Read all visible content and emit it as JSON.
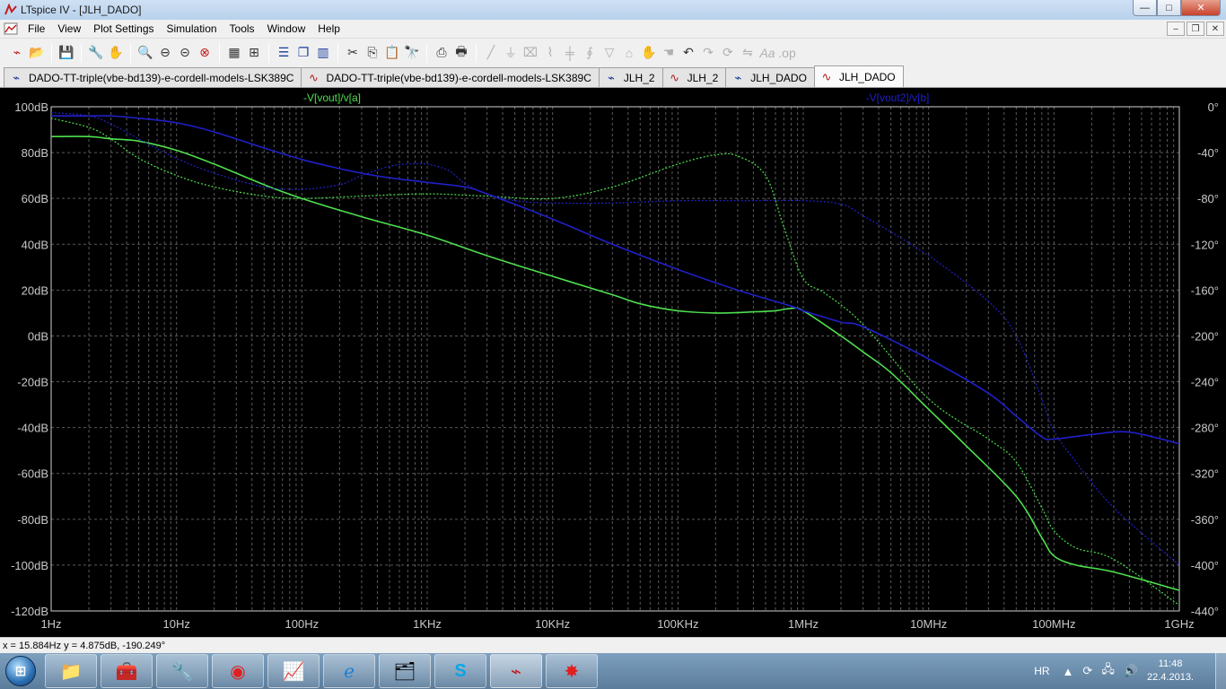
{
  "window": {
    "title": "LTspice IV - [JLH_DADO]",
    "controls": {
      "minimize": "—",
      "maximize": "□",
      "close": "✕"
    }
  },
  "menu": {
    "items": [
      "File",
      "View",
      "Plot Settings",
      "Simulation",
      "Tools",
      "Window",
      "Help"
    ],
    "mdi_controls": {
      "minimize": "–",
      "restore": "❐",
      "close": "✕"
    }
  },
  "toolbar": {
    "groups": [
      [
        "schematic-run-icon",
        "open-icon"
      ],
      [
        "save-icon"
      ],
      [
        "control-panel-icon",
        "hand-pan-icon"
      ],
      [
        "zoom-in-icon",
        "zoom-out-icon",
        "zoom-back-icon",
        "zoom-fit-icon"
      ],
      [
        "autorange-icon",
        "marker-icon"
      ],
      [
        "tile-horizontal-icon",
        "cascade-icon",
        "tile-vertical-icon"
      ],
      [
        "cut-icon",
        "copy-icon",
        "paste-icon",
        "find-icon"
      ],
      [
        "print-setup-icon",
        "print-icon"
      ],
      [
        "wire-icon",
        "ground-icon",
        "label-icon",
        "resistor-icon",
        "capacitor-icon",
        "inductor-icon",
        "diode-icon",
        "component-icon",
        "move-icon",
        "drag-icon",
        "undo-icon",
        "redo-icon",
        "rotate-icon",
        "mirror-icon",
        "text-icon",
        "spice-directive-icon"
      ]
    ]
  },
  "tabs": [
    {
      "label": "DADO-TT-triple(vbe-bd139)-e-cordell-models-LSK389C",
      "type": "schematic",
      "active": false
    },
    {
      "label": "DADO-TT-triple(vbe-bd139)-e-cordell-models-LSK389C",
      "type": "plot",
      "active": false
    },
    {
      "label": "JLH_2",
      "type": "schematic",
      "active": false
    },
    {
      "label": "JLH_2",
      "type": "plot",
      "active": false
    },
    {
      "label": "JLH_DADO",
      "type": "schematic",
      "active": false
    },
    {
      "label": "JLH_DADO",
      "type": "plot",
      "active": true
    }
  ],
  "colors": {
    "green_trace": "#4ee04e",
    "blue_trace": "#2020c8",
    "grid": "#5a5a5a",
    "axis_text": "#c8c8c8",
    "plot_bg": "#000000"
  },
  "chart_data": {
    "type": "line",
    "title": "",
    "x_scale": "log",
    "xlim": [
      1,
      1000000000
    ],
    "x_ticks": [
      {
        "value": 1,
        "label": "1Hz"
      },
      {
        "value": 10,
        "label": "10Hz"
      },
      {
        "value": 100,
        "label": "100Hz"
      },
      {
        "value": 1000,
        "label": "1KHz"
      },
      {
        "value": 10000,
        "label": "10KHz"
      },
      {
        "value": 100000,
        "label": "100KHz"
      },
      {
        "value": 1000000,
        "label": "1MHz"
      },
      {
        "value": 10000000,
        "label": "10MHz"
      },
      {
        "value": 100000000,
        "label": "100MHz"
      },
      {
        "value": 1000000000,
        "label": "1GHz"
      }
    ],
    "y_left": {
      "unit": "dB",
      "ylim": [
        -120,
        100
      ],
      "ticks": [
        {
          "value": 100,
          "label": "100dB"
        },
        {
          "value": 80,
          "label": "80dB"
        },
        {
          "value": 60,
          "label": "60dB"
        },
        {
          "value": 40,
          "label": "40dB"
        },
        {
          "value": 20,
          "label": "20dB"
        },
        {
          "value": 0,
          "label": "0dB"
        },
        {
          "value": -20,
          "label": "-20dB"
        },
        {
          "value": -40,
          "label": "-40dB"
        },
        {
          "value": -60,
          "label": "-60dB"
        },
        {
          "value": -80,
          "label": "-80dB"
        },
        {
          "value": -100,
          "label": "-100dB"
        },
        {
          "value": -120,
          "label": "-120dB"
        }
      ]
    },
    "y_right": {
      "unit": "°",
      "ylim": [
        -440,
        0
      ],
      "ticks": [
        {
          "value": 0,
          "label": "0°"
        },
        {
          "value": -40,
          "label": "-40°"
        },
        {
          "value": -80,
          "label": "-80°"
        },
        {
          "value": -120,
          "label": "-120°"
        },
        {
          "value": -160,
          "label": "-160°"
        },
        {
          "value": -200,
          "label": "-200°"
        },
        {
          "value": -240,
          "label": "-240°"
        },
        {
          "value": -280,
          "label": "-280°"
        },
        {
          "value": -320,
          "label": "-320°"
        },
        {
          "value": -360,
          "label": "-360°"
        },
        {
          "value": -400,
          "label": "-400°"
        },
        {
          "value": -440,
          "label": "-440°"
        }
      ]
    },
    "grid": true,
    "series": [
      {
        "name": "-V[vout]/v[a]",
        "color": "#4ee04e",
        "axis": "left",
        "style": "solid",
        "x": [
          1,
          2,
          3,
          5,
          10,
          20,
          50,
          100,
          300,
          1000,
          3000,
          10000,
          30000,
          50000,
          100000,
          200000,
          400000,
          600000,
          800000,
          1000000,
          2000000,
          3000000,
          5000000,
          10000000,
          20000000,
          50000000,
          80000000,
          100000000,
          150000000,
          300000000,
          1000000000
        ],
        "y": [
          87,
          87,
          86,
          85,
          81,
          75,
          66,
          60,
          52,
          44,
          35,
          26,
          18,
          14,
          11,
          10,
          10.5,
          11,
          12,
          11,
          0,
          -7,
          -16,
          -32,
          -48,
          -70,
          -88,
          -96,
          -100,
          -103,
          -111
        ]
      },
      {
        "name": "-V[vout]/v[a] phase",
        "color": "#4ee04e",
        "axis": "right",
        "style": "dotted",
        "x": [
          1,
          2,
          3,
          5,
          10,
          20,
          50,
          100,
          300,
          1000,
          3000,
          10000,
          30000,
          100000,
          200000,
          300000,
          500000,
          700000,
          1000000,
          1500000,
          3000000,
          10000000,
          30000000,
          50000000,
          80000000,
          100000000,
          150000000,
          300000000,
          1000000000
        ],
        "y": [
          -10,
          -18,
          -28,
          -45,
          -60,
          -70,
          -78,
          -80,
          -78,
          -76,
          -78,
          -80,
          -70,
          -50,
          -42,
          -43,
          -60,
          -105,
          -150,
          -163,
          -190,
          -255,
          -290,
          -310,
          -350,
          -370,
          -385,
          -395,
          -435
        ]
      },
      {
        "name": "-V[vout2]/v[b]",
        "color": "#2020c8",
        "axis": "left",
        "style": "solid",
        "x": [
          1,
          2,
          3,
          5,
          10,
          20,
          50,
          100,
          200,
          300,
          500,
          1000,
          2000,
          3000,
          10000,
          30000,
          100000,
          300000,
          800000,
          1000000,
          2000000,
          3000000,
          10000000,
          30000000,
          50000000,
          80000000,
          100000000,
          200000000,
          400000000,
          1000000000
        ],
        "y": [
          96,
          96,
          96,
          95,
          93,
          89,
          82,
          77,
          73,
          71,
          69,
          67,
          65,
          62,
          51,
          40,
          29,
          20,
          13,
          11,
          6,
          4,
          -10,
          -25,
          -35,
          -44,
          -45,
          -43,
          -42,
          -47
        ]
      },
      {
        "name": "-V[vout2]/v[b] phase",
        "color": "#2020c8",
        "axis": "right",
        "style": "dotted",
        "x": [
          1,
          2,
          3,
          5,
          10,
          20,
          50,
          100,
          200,
          300,
          500,
          700,
          1000,
          1500,
          2000,
          3000,
          5000,
          10000,
          30000,
          100000,
          300000,
          1000000,
          2000000,
          3000000,
          10000000,
          30000000,
          50000000,
          80000000,
          100000000,
          150000000,
          300000000,
          1000000000
        ],
        "y": [
          -5,
          -8,
          -15,
          -28,
          -45,
          -58,
          -70,
          -72,
          -68,
          -60,
          -52,
          -50,
          -50,
          -56,
          -67,
          -76,
          -82,
          -84,
          -84,
          -82,
          -82,
          -82,
          -85,
          -95,
          -130,
          -170,
          -200,
          -255,
          -283,
          -310,
          -350,
          -400
        ]
      }
    ]
  },
  "legend": {
    "left_trace": "-V[vout]/v[a]",
    "right_trace": "-V[vout2]/v[b]"
  },
  "status": {
    "cursor_readout": "x = 15.884Hz   y = 4.875dB, -190.249°"
  },
  "taskbar": {
    "apps": [
      "explorer-icon",
      "cpanel-icon",
      "tool-icon",
      "antivirus-icon",
      "scope-icon",
      "ie-icon",
      "folder-icon",
      "skype-icon",
      "ltspice-icon",
      "splash-icon"
    ],
    "tray": {
      "language": "HR",
      "time": "11:48",
      "date": "22.4.2013."
    }
  }
}
